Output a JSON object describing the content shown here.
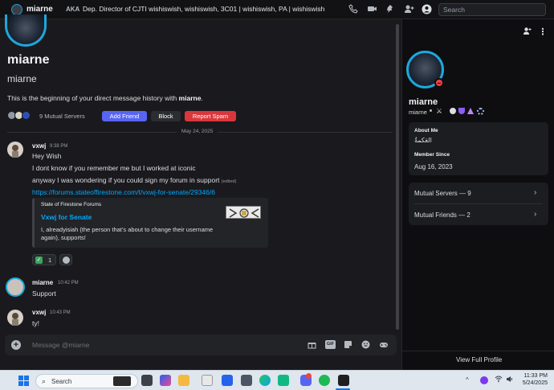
{
  "topbar": {
    "name": "miarne",
    "aka_label": "AKA",
    "aka_text": "Dep. Director of CJTI wishiswish, wishiswish, 3C01 | wishiswish, PA | wishiswish",
    "search_placeholder": "Search"
  },
  "header": {
    "display_name": "miarne",
    "username": "miarne",
    "intro_prefix": "This is the beginning of your direct message history with ",
    "intro_name": "miarne",
    "intro_suffix": ".",
    "mutual_servers": "9 Mutual Servers",
    "add_friend": "Add Friend",
    "block": "Block",
    "report_spam": "Report Spam"
  },
  "date_divider": "May 24, 2025",
  "messages": [
    {
      "author": "vxwj",
      "time": "9:38 PM",
      "lines": [
        "Hey Wish",
        "I dont know if you remember me but I worked at iconic",
        "anyway I was wondering if you could sign my forum in support"
      ],
      "edited": "(edited)",
      "link": "https://forums.stateoffirestone.com/t/vxwj-for-senate/29346/6",
      "embed": {
        "site": "State of Firestone Forums",
        "title": "Vxwj for Senate",
        "desc_1": "I, alreadyisiah (the person that’s about to change their username",
        "desc_2": "again), supports!"
      },
      "reaction_emoji": "✅",
      "reaction_count": "1"
    },
    {
      "author": "miarne",
      "time": "10:42 PM",
      "text": "Support"
    },
    {
      "author": "vxwj",
      "time": "10:43 PM",
      "text": "ty!"
    }
  ],
  "composer": {
    "placeholder": "Message @miarne"
  },
  "profile": {
    "display_name": "miarne",
    "username": "miarne",
    "about_label": "About Me",
    "about_value": "العَكمةٌ",
    "member_since_label": "Member Since",
    "member_since_value": "Aug 16, 2023",
    "mutual_servers": "Mutual Servers — 9",
    "mutual_friends": "Mutual Friends — 2",
    "view_full": "View Full Profile"
  },
  "taskbar": {
    "search": "Search",
    "time": "11:33 PM",
    "date": "5/24/2025"
  },
  "colors": {
    "accent": "#5865f2",
    "danger": "#da373c",
    "link": "#00a8fc",
    "status_dnd": "#f23f43",
    "avatar_ring": "#1fa7dc"
  }
}
